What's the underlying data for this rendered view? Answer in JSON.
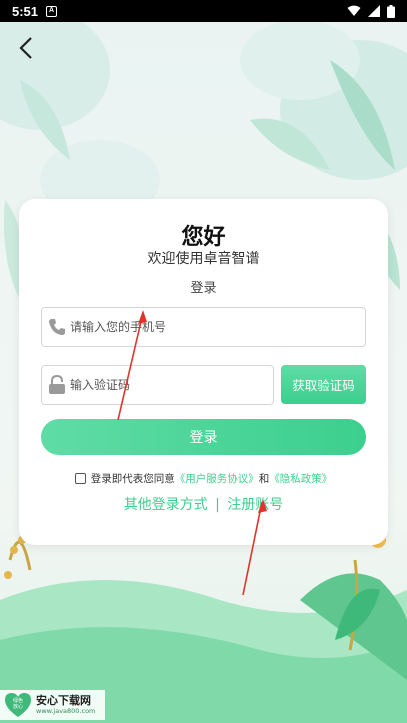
{
  "status_bar": {
    "time": "5:51",
    "notification_icon": "A"
  },
  "card": {
    "greeting": "您好",
    "subtitle": "欢迎使用卓音智谱",
    "heading": "登录"
  },
  "phone": {
    "placeholder": "请输入您的手机号",
    "icon": "phone-icon"
  },
  "code": {
    "placeholder": "输入验证码",
    "icon": "lock-icon",
    "get_code_label": "获取验证码"
  },
  "login_button_label": "登录",
  "agreement": {
    "prefix": "登录即代表您同意",
    "user_agreement": "《用户服务协议》",
    "and": "和",
    "privacy_policy": "《隐私政策》"
  },
  "other": {
    "other_methods": "其他登录方式",
    "separator": "|",
    "register": "注册账号"
  },
  "watermark": {
    "title": "安心下载网",
    "url": "www.java800.com",
    "badge_line1": "绿色",
    "badge_line2": "放心"
  },
  "colors": {
    "accent": "#3ccf8e",
    "arrow": "#e0342b"
  }
}
